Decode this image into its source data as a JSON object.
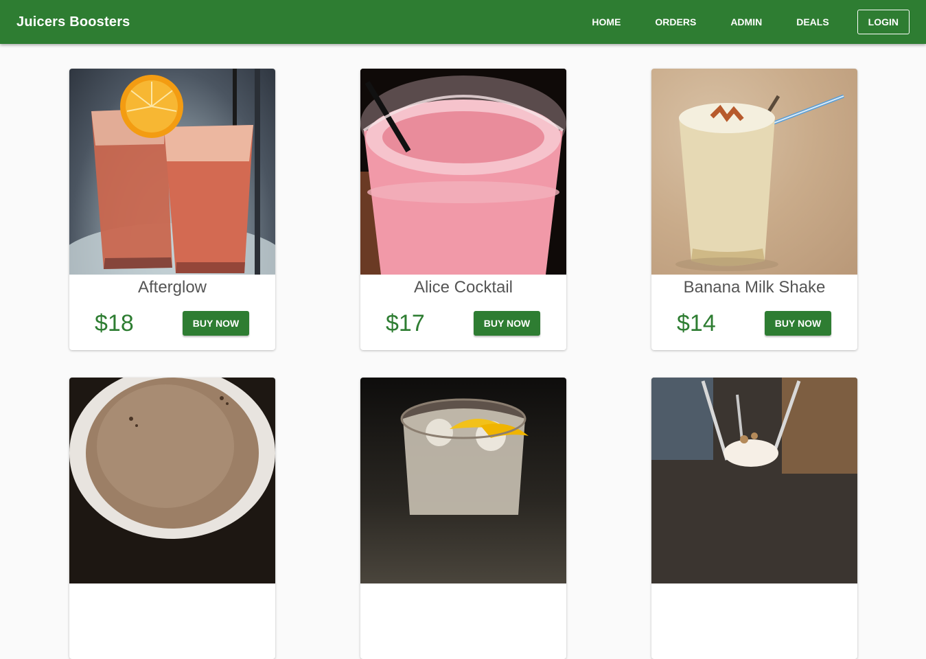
{
  "nav": {
    "brand": "Juicers Boosters",
    "links": [
      "HOME",
      "ORDERS",
      "ADMIN",
      "DEALS"
    ],
    "login": "LOGIN"
  },
  "colors": {
    "primary": "#2e7d32",
    "background": "#fafafa",
    "title_text": "#555555"
  },
  "products": [
    {
      "name": "Afterglow",
      "price": "$18",
      "button": "BUY NOW",
      "image": "afterglow-drink-image"
    },
    {
      "name": "Alice Cocktail",
      "price": "$17",
      "button": "BUY NOW",
      "image": "alice-cocktail-image"
    },
    {
      "name": "Banana Milk Shake",
      "price": "$14",
      "button": "BUY NOW",
      "image": "banana-milk-shake-image"
    }
  ],
  "partial_products": [
    {
      "image": "coffee-drink-image"
    },
    {
      "image": "lemon-drink-image"
    },
    {
      "image": "milkshake-drink-image"
    }
  ]
}
